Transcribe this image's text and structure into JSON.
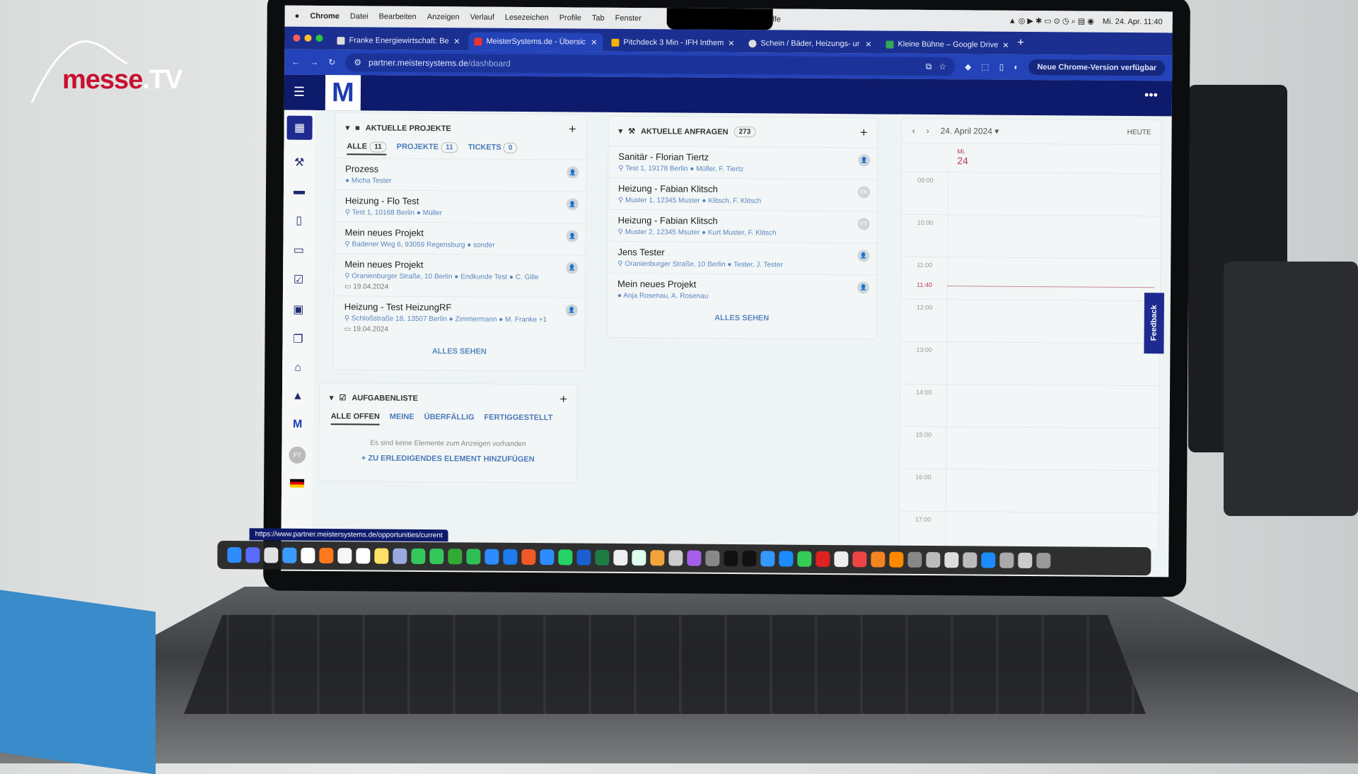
{
  "watermark": {
    "text": "messe.TV"
  },
  "mac_menu": {
    "app": "Chrome",
    "items": [
      "Datei",
      "Bearbeiten",
      "Anzeigen",
      "Verlauf",
      "Lesezeichen",
      "Profile",
      "Tab",
      "Fenster",
      "Hilfe"
    ],
    "datetime": "Mi. 24. Apr. 11:40"
  },
  "browser": {
    "tabs": [
      {
        "title": "Franke Energiewirtschaft: Be",
        "active": false
      },
      {
        "title": "MeisterSystems.de - Übersic",
        "active": true
      },
      {
        "title": "Pitchdeck 3 Min - IFH Inthem",
        "active": false
      },
      {
        "title": "Schein / Bäder, Heizungs- ur",
        "active": false
      },
      {
        "title": "Kleine Bühne – Google Drive",
        "active": false
      }
    ],
    "url_host": "partner.meistersystems.de",
    "url_path": "/dashboard",
    "update_label": "Neue Chrome-Version verfügbar",
    "status_url": "https://www.partner.meistersystems.de/opportunities/current"
  },
  "app": {
    "logo": "M",
    "brand_color": "#0e1a6b",
    "accent": "#f07c00"
  },
  "sidebar": {
    "icons": [
      "grid-icon",
      "gavel-icon",
      "folder-icon",
      "document-icon",
      "calendar-icon",
      "checklist-icon",
      "contact-icon",
      "files-icon",
      "basket-icon",
      "shapes-icon",
      "m-logo-icon",
      "avatar-icon",
      "flag-icon"
    ],
    "avatar": "FT"
  },
  "projects": {
    "title": "AKTUELLE PROJEKTE",
    "tabs": [
      {
        "label": "ALLE",
        "count": "11"
      },
      {
        "label": "PROJEKTE",
        "count": "11"
      },
      {
        "label": "TICKETS",
        "count": "0"
      }
    ],
    "items": [
      {
        "title": "Prozess",
        "meta": [
          "Micha Tester"
        ],
        "date": ""
      },
      {
        "title": "Heizung - Flo Test",
        "meta": [
          "Test 1, 10168 Berlin",
          "Müller"
        ],
        "date": ""
      },
      {
        "title": "Mein neues Projekt",
        "meta": [
          "Badener Weg 6, 93059 Regensburg",
          "sonder"
        ],
        "date": ""
      },
      {
        "title": "Mein neues Projekt",
        "meta": [
          "Oranienburger Straße, 10 Berlin",
          "Endkunde Test",
          "C. Gille"
        ],
        "date": "19.04.2024"
      },
      {
        "title": "Heizung - Test HeizungRF",
        "meta": [
          "Schloßstraße 18, 13507 Berlin",
          "Zimmermann",
          "M. Franke +1"
        ],
        "date": "19.04.2024"
      }
    ],
    "see_all": "ALLES SEHEN"
  },
  "requests": {
    "title": "AKTUELLE ANFRAGEN",
    "count": "273",
    "items": [
      {
        "title": "Sanitär - Florian Tiertz",
        "meta": [
          "Test 1, 19178 Berlin",
          "Müller, F. Tiertz"
        ],
        "avatar": ""
      },
      {
        "title": "Heizung - Fabian Klitsch",
        "meta": [
          "Muster 1, 12345 Muster",
          "Klitsch, F. Klitsch"
        ],
        "avatar": "FK"
      },
      {
        "title": "Heizung - Fabian Klitsch",
        "meta": [
          "Muster 2, 12345 Msuter",
          "Kurt Muster, F. Klitsch"
        ],
        "avatar": "FT"
      },
      {
        "title": "Jens Tester",
        "meta": [
          "Oranienburger Straße, 10 Berlin",
          "Tester, J. Tester"
        ],
        "avatar": ""
      },
      {
        "title": "Mein neues Projekt",
        "meta": [
          "Anja Rosenau, A. Rosenau"
        ],
        "avatar": ""
      }
    ],
    "see_all": "ALLES SEHEN"
  },
  "tasks": {
    "title": "AUFGABENLISTE",
    "tabs": [
      "ALLE OFFEN",
      "MEINE",
      "ÜBERFÄLLIG",
      "FERTIGGESTELLT"
    ],
    "empty": "Es sind keine Elemente zum Anzeigen vorhanden",
    "add": "ZU ERLEDIGENDES ELEMENT HINZUFÜGEN"
  },
  "calendar": {
    "date": "24. April 2024",
    "today": "HEUTE",
    "day_name": "Mi.",
    "day_num": "24",
    "hours": [
      "09:00",
      "10:00",
      "11:00",
      "12:00",
      "13:00",
      "14:00",
      "15:00",
      "16:00",
      "17:00"
    ],
    "now": "11:40"
  },
  "feedback": "Feedback"
}
